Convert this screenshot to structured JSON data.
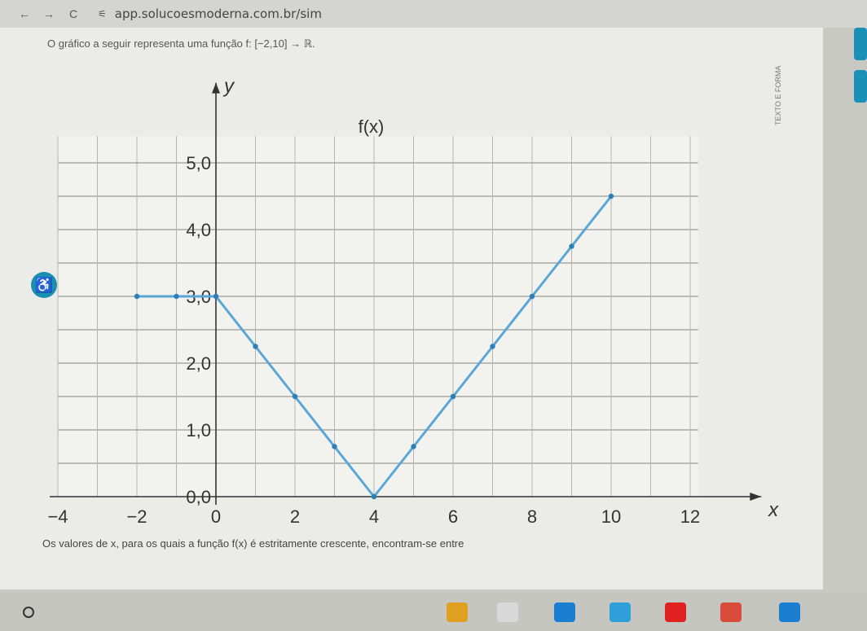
{
  "browser": {
    "back_glyph": "←",
    "forward_glyph": "→",
    "reload_glyph": "C",
    "url": "app.solucoesmoderna.com.br/sim"
  },
  "question": {
    "intro": "O gráfico a seguir representa uma função f: [−2,10] → ℝ."
  },
  "footer": {
    "text": "Os valores de x, para os quais a função f(x) é estritamente crescente, encontram-se entre"
  },
  "side_tag": "TEXTO E FORMA",
  "chart_data": {
    "type": "line",
    "function_label": "f(x)",
    "xlabel": "x",
    "ylabel": "y",
    "x_ticks": [
      -4,
      -2,
      0,
      2,
      4,
      6,
      8,
      10,
      12
    ],
    "x_tick_labels": [
      "−4",
      "−2",
      "0",
      "2",
      "4",
      "6",
      "8",
      "10",
      "12"
    ],
    "y_ticks": [
      0,
      1,
      2,
      3,
      4,
      5
    ],
    "y_tick_labels": [
      "0,0",
      "1,0",
      "2,0",
      "3,0",
      "4,0",
      "5,0"
    ],
    "xlim": [
      -4,
      12
    ],
    "ylim": [
      0,
      5.4
    ],
    "grid": true,
    "line_color": "#5aa6d4",
    "point_color": "#2d7fb8",
    "series": [
      {
        "x": [
          -2,
          -1,
          0,
          1,
          2,
          3,
          4,
          5,
          6,
          7,
          8,
          9,
          10
        ],
        "y": [
          3,
          3,
          3,
          2.25,
          1.5,
          0.75,
          0,
          0.75,
          1.5,
          2.25,
          3,
          3.75,
          4.5
        ]
      }
    ]
  },
  "colors": {
    "accent": "#1a8fb0"
  },
  "taskbar": {
    "apps": [
      {
        "name": "chrome",
        "color": "#e0a020"
      },
      {
        "name": "gmail",
        "color": "#d8d8d8"
      },
      {
        "name": "files",
        "color": "#1a7fd0"
      },
      {
        "name": "play-store",
        "color": "#2e9fd8"
      },
      {
        "name": "youtube",
        "color": "#e02020"
      },
      {
        "name": "photos",
        "color": "#d94c3c"
      },
      {
        "name": "keep",
        "color": "#1a7fd0"
      }
    ]
  }
}
